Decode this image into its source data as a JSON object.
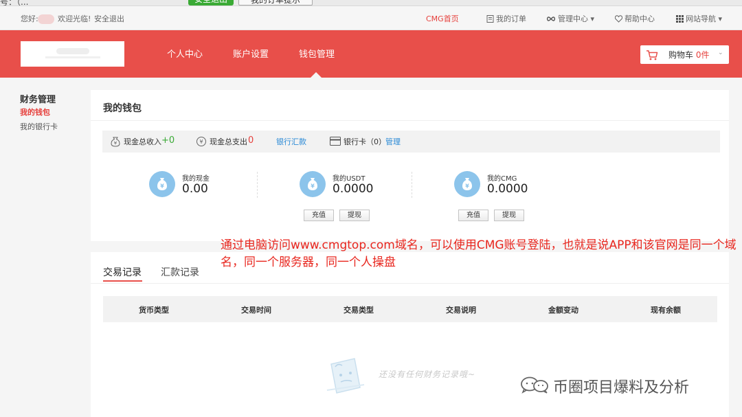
{
  "browser": {
    "partial_text": "号：（...",
    "green_button": "安全退出",
    "button": "我的订单提示"
  },
  "topbar": {
    "greeting": "您好:",
    "welcome": "欢迎光临!",
    "logout": "安全退出",
    "home_link": "CMG首页",
    "orders": "我的订单",
    "manage": "管理中心 ▾",
    "help": "帮助中心",
    "sitenav": "网站导航 ▾"
  },
  "header": {
    "nav": [
      "个人中心",
      "账户设置",
      "钱包管理"
    ],
    "active_nav": "钱包管理",
    "cart_label": "购物车",
    "cart_count": "0件"
  },
  "sidebar": {
    "title": "财务管理",
    "items": [
      {
        "label": "我的钱包",
        "active": true
      },
      {
        "label": "我的银行卡",
        "active": false
      }
    ]
  },
  "wallet": {
    "title": "我的钱包",
    "summary": {
      "income_label": "现金总收入",
      "income_value": "+0",
      "expense_label": "现金总支出",
      "expense_value": "0",
      "bank_transfer": "银行汇款",
      "bank_card": "银行卡（0）",
      "manage": "管理"
    },
    "accounts": [
      {
        "label": "我的现金",
        "value": "0.00"
      },
      {
        "label": "我的USDT",
        "value": "0.0000",
        "buttons": [
          "充值",
          "提现"
        ]
      },
      {
        "label": "我的CMG",
        "value": "0.0000",
        "buttons": [
          "充值",
          "提现"
        ]
      }
    ]
  },
  "records": {
    "tabs": [
      "交易记录",
      "汇款记录"
    ],
    "columns": [
      "货币类型",
      "交易时间",
      "交易类型",
      "交易说明",
      "金额变动",
      "现有余额"
    ],
    "empty_text": "还没有任何财务记录哦~"
  },
  "annotation": "通过电脑访问www.cmgtop.com域名，可以使用CMG账号登陆，也就是说APP和该官网是同一个域名，同一个服务器，同一个人操盘",
  "watermark": "币圈项目爆料及分析",
  "colors": {
    "brand_red": "#e84f4a",
    "link_blue": "#2b8ad6",
    "income_green": "#3aaa35",
    "icon_blue": "#8cc4eb",
    "annotation_red": "#e8261e"
  }
}
